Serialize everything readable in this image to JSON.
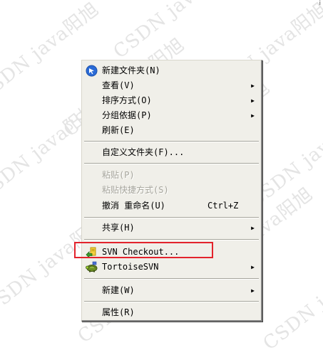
{
  "corner_glyph": "i",
  "watermark": {
    "text": "CSDN java阳旭"
  },
  "context_menu": {
    "items": [
      {
        "label": "新建文件夹(N)",
        "icon": "new-folder-arrow-icon",
        "submenu": false
      },
      {
        "label": "查看(V)",
        "submenu": true
      },
      {
        "label": "排序方式(O)",
        "submenu": true
      },
      {
        "label": "分组依据(P)",
        "submenu": true
      },
      {
        "label": "刷新(E)",
        "submenu": false
      },
      {
        "label": "自定义文件夹(F)...",
        "submenu": false
      },
      {
        "label": "粘贴(P)",
        "disabled": true
      },
      {
        "label": "粘贴快捷方式(S)",
        "disabled": true
      },
      {
        "label": "撤消 重命名(U)",
        "shortcut": "Ctrl+Z"
      },
      {
        "label": "共享(H)",
        "submenu": true
      },
      {
        "label": "SVN Checkout...",
        "icon": "svn-checkout-icon",
        "submenu": false
      },
      {
        "label": "TortoiseSVN",
        "icon": "tortoisesvn-icon",
        "submenu": true
      },
      {
        "label": "新建(W)",
        "submenu": true
      },
      {
        "label": "属性(R)",
        "submenu": false
      }
    ],
    "submenu_arrow": "▶",
    "highlight_color": "#e3232c"
  }
}
